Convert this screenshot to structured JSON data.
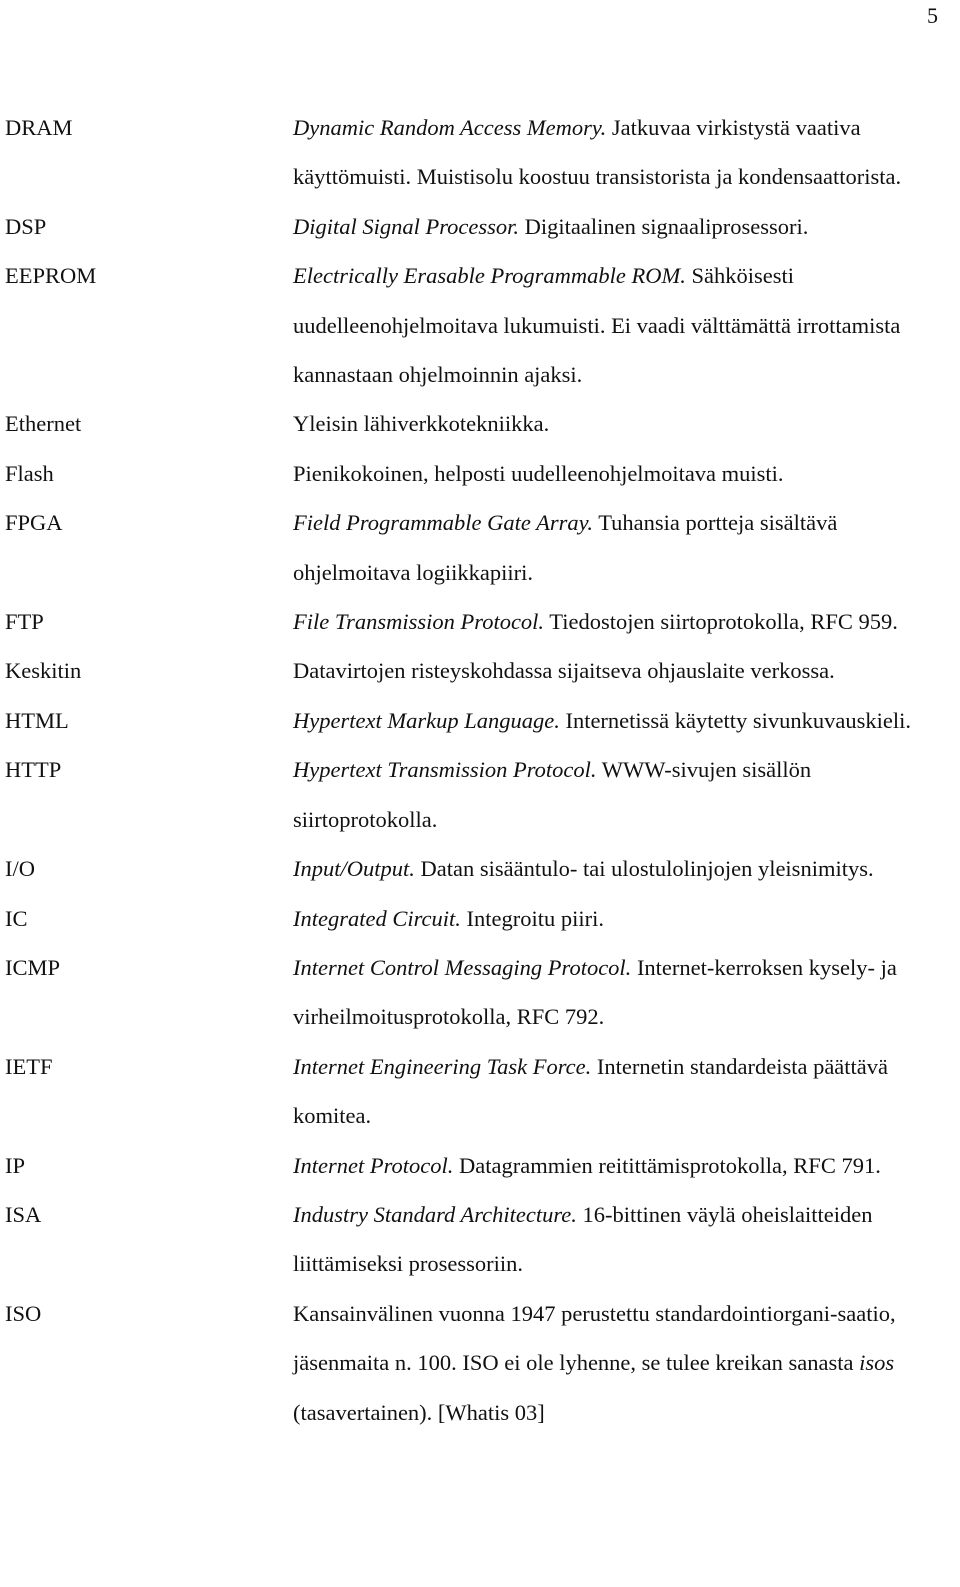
{
  "page": {
    "number": "5",
    "type": "glossary-page",
    "language": "fi"
  },
  "glossary": {
    "entries": [
      {
        "term": "DRAM",
        "expansion": "Dynamic Random Access Memory.",
        "description": " Jatkuvaa virkistystä vaativa käyttömuisti. Muistisolu koostuu transistorista ja kondensaattorista."
      },
      {
        "term": "DSP",
        "expansion": "Digital Signal Processor.",
        "description": " Digitaalinen signaaliprosessori."
      },
      {
        "term": "EEPROM",
        "expansion": "Electrically Erasable Programmable ROM.",
        "description": " Sähköisesti uudelleenohjelmoitava lukumuisti. Ei vaadi välttämättä irrottamista kannastaan ohjelmoinnin ajaksi."
      },
      {
        "term": "Ethernet",
        "expansion": "",
        "description": "Yleisin lähiverkkotekniikka."
      },
      {
        "term": "Flash",
        "expansion": "",
        "description": "Pienikokoinen, helposti uudelleenohjelmoitava muisti."
      },
      {
        "term": "FPGA",
        "expansion": "Field Programmable Gate Array.",
        "description": " Tuhansia portteja sisältävä ohjelmoitava logiikkapiiri."
      },
      {
        "term": "FTP",
        "expansion": "File Transmission Protocol.",
        "description": " Tiedostojen siirtoprotokolla, RFC 959."
      },
      {
        "term": "Keskitin",
        "expansion": "",
        "description": "Datavirtojen risteyskohdassa sijaitseva ohjauslaite verkossa."
      },
      {
        "term": "HTML",
        "expansion": "Hypertext Markup Language.",
        "description": " Internetissä käytetty sivunkuvauskieli."
      },
      {
        "term": "HTTP",
        "expansion": "Hypertext Transmission Protocol.",
        "description": " WWW-sivujen sisällön siirtoprotokolla."
      },
      {
        "term": "I/O",
        "expansion": "Input/Output.",
        "description": " Datan sisääntulo- tai ulostulolinjojen yleisnimitys."
      },
      {
        "term": "IC",
        "expansion": "Integrated Circuit.",
        "description": " Integroitu piiri."
      },
      {
        "term": "ICMP",
        "expansion": "Internet Control Messaging Protocol.",
        "description": " Internet-kerroksen kysely- ja virheilmoitusprotokolla, RFC 792."
      },
      {
        "term": "IETF",
        "expansion": "Internet Engineering Task Force.",
        "description": " Internetin standardeista päättävä komitea."
      },
      {
        "term": "IP",
        "expansion": "Internet Protocol.",
        "description": " Datagrammien reitittämisprotokolla, RFC 791."
      },
      {
        "term": "ISA",
        "expansion": "Industry Standard Architecture.",
        "description": " 16-bittinen väylä oheislaitteiden liittämiseksi prosessoriin."
      },
      {
        "term": "ISO",
        "expansion": "",
        "description": "Kansainvälinen vuonna 1947 perustettu standardointiorgani-saatio, jäsenmaita n. 100. ISO ei ole lyhenne, se tulee kreikan sanasta ",
        "description_italic_tail": "isos",
        "description_tail": " (tasavertainen). [Whatis 03]"
      }
    ]
  }
}
